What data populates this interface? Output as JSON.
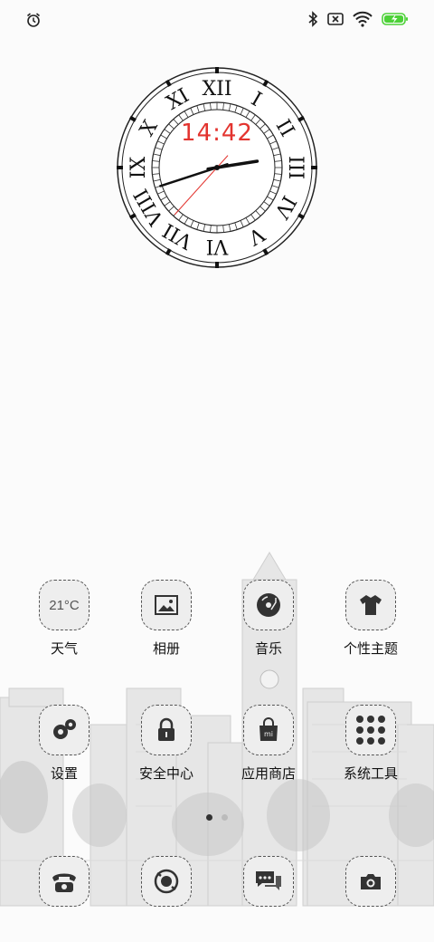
{
  "status_bar": {
    "left_icons": [
      "alarm-icon"
    ],
    "right_icons": [
      "bluetooth-icon",
      "no-sim-icon",
      "wifi-icon",
      "battery-charging-icon"
    ],
    "battery_color": "#4cd137"
  },
  "clock_widget": {
    "digital_time": "14:42",
    "digital_color": "#e3342f",
    "numerals": [
      "XII",
      "I",
      "II",
      "III",
      "IV",
      "V",
      "VI",
      "VII",
      "VIII",
      "IX",
      "X",
      "XI"
    ]
  },
  "home": {
    "rows": [
      [
        {
          "label": "天气",
          "icon": "weather-widget",
          "tile_text": "21°C"
        },
        {
          "label": "相册",
          "icon": "gallery-icon",
          "tile_text": ""
        },
        {
          "label": "音乐",
          "icon": "music-disc-icon",
          "tile_text": ""
        },
        {
          "label": "个性主题",
          "icon": "theme-shirt-icon",
          "tile_text": ""
        }
      ],
      [
        {
          "label": "设置",
          "icon": "gear-icon",
          "tile_text": ""
        },
        {
          "label": "安全中心",
          "icon": "lock-icon",
          "tile_text": ""
        },
        {
          "label": "应用商店",
          "icon": "shopping-bag-icon",
          "tile_text": ""
        },
        {
          "label": "系统工具",
          "icon": "folder-icon",
          "tile_text": ""
        }
      ]
    ],
    "page_indicator": {
      "pages": 2,
      "current": 1
    }
  },
  "dock": [
    {
      "icon": "phone-icon"
    },
    {
      "icon": "browser-icon"
    },
    {
      "icon": "messages-icon"
    },
    {
      "icon": "camera-icon"
    }
  ]
}
